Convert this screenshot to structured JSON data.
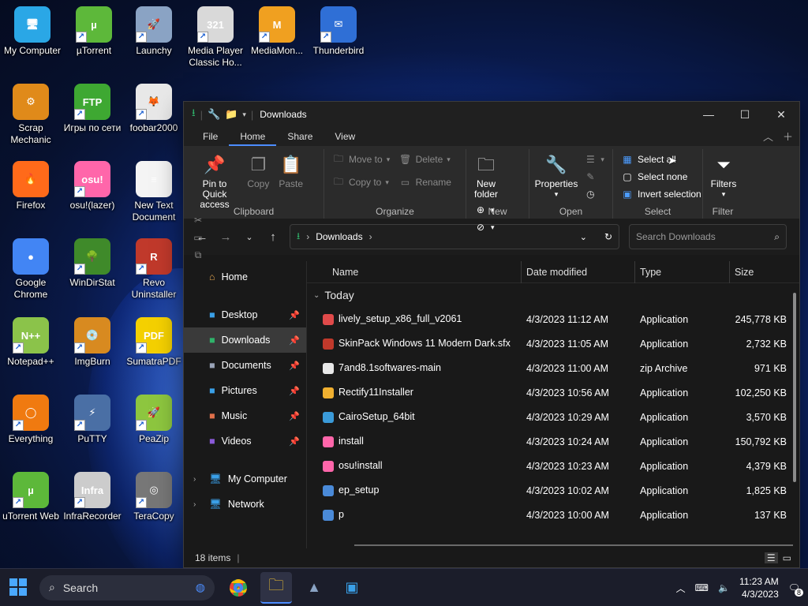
{
  "desktop": {
    "icons": [
      {
        "label": "My Computer",
        "color": "#2aa7e6",
        "glyph": "🖥"
      },
      {
        "label": "µTorrent",
        "color": "#5db83a",
        "glyph": "µ",
        "sc": true
      },
      {
        "label": "Launchy",
        "color": "#8aa3c4",
        "glyph": "🚀",
        "sc": true
      },
      {
        "label": "Media Player Classic Ho...",
        "color": "#d9d9d9",
        "glyph": "321",
        "sc": true
      },
      {
        "label": "MediaMon...",
        "color": "#f0a020",
        "glyph": "M",
        "sc": true
      },
      {
        "label": "Thunderbird",
        "color": "#2f6fd6",
        "glyph": "✉",
        "sc": true
      },
      {
        "label": "Scrap Mechanic",
        "color": "#e08a1a",
        "glyph": "⚙"
      },
      {
        "label": "Игры по сети",
        "color": "#3ea832",
        "glyph": "FTP",
        "sc": true
      },
      {
        "label": "foobar2000",
        "color": "#e8e8e8",
        "glyph": "🦊",
        "sc": true
      },
      {
        "label": "Firefox",
        "color": "#ff6a1a",
        "glyph": "🔥"
      },
      {
        "label": "osu!(lazer)",
        "color": "#ff66aa",
        "glyph": "osu!",
        "sc": true
      },
      {
        "label": "New Text Document",
        "color": "#f4f4f4",
        "glyph": "≡"
      },
      {
        "label": "Google Chrome",
        "color": "#4285f4",
        "glyph": "●"
      },
      {
        "label": "WinDirStat",
        "color": "#3f8a2a",
        "glyph": "🌳",
        "sc": true
      },
      {
        "label": "Revo Uninstaller",
        "color": "#c0392b",
        "glyph": "R",
        "sc": true
      },
      {
        "label": "Notepad++",
        "color": "#8bc34a",
        "glyph": "N++",
        "sc": true
      },
      {
        "label": "ImgBurn",
        "color": "#d88a20",
        "glyph": "💿",
        "sc": true
      },
      {
        "label": "SumatraPDF",
        "color": "#f4d000",
        "glyph": "PDF",
        "sc": true
      },
      {
        "label": "Everything",
        "color": "#f07a10",
        "glyph": "◯",
        "sc": true
      },
      {
        "label": "PuTTY",
        "color": "#4a6fa5",
        "glyph": "⚡",
        "sc": true
      },
      {
        "label": "PeaZip",
        "color": "#8dc63f",
        "glyph": "🚀",
        "sc": true
      },
      {
        "label": "uTorrent Web",
        "color": "#5db83a",
        "glyph": "µ",
        "sc": true
      },
      {
        "label": "InfraRecorder",
        "color": "#cccccc",
        "glyph": "Infra",
        "sc": true
      },
      {
        "label": "TeraCopy",
        "color": "#777777",
        "glyph": "◎",
        "sc": true
      }
    ]
  },
  "explorer": {
    "title": "Downloads",
    "tabs": [
      "File",
      "Home",
      "Share",
      "View"
    ],
    "active_tab": "Home",
    "ribbon": {
      "clipboard": {
        "pin": "Pin to Quick access",
        "copy": "Copy",
        "paste": "Paste",
        "label": "Clipboard"
      },
      "organize": {
        "move_to": "Move to",
        "copy_to": "Copy to",
        "delete": "Delete",
        "rename": "Rename",
        "label": "Organize"
      },
      "new": {
        "new_folder": "New folder",
        "label": "New"
      },
      "open": {
        "properties": "Properties",
        "label": "Open"
      },
      "select": {
        "select_all": "Select all",
        "select_none": "Select none",
        "invert": "Invert selection",
        "label": "Select"
      },
      "filter": {
        "filters": "Filters",
        "label": "Filter"
      }
    },
    "address": {
      "path": "Downloads",
      "search_placeholder": "Search Downloads"
    },
    "nav": {
      "home": "Home",
      "quick": [
        {
          "label": "Desktop",
          "color": "#3aa0e8"
        },
        {
          "label": "Downloads",
          "color": "#2fb36a",
          "selected": true
        },
        {
          "label": "Documents",
          "color": "#9aa4b8"
        },
        {
          "label": "Pictures",
          "color": "#3aa0e8"
        },
        {
          "label": "Music",
          "color": "#e0704a"
        },
        {
          "label": "Videos",
          "color": "#8a5ad8"
        }
      ],
      "tree": [
        {
          "label": "My Computer"
        },
        {
          "label": "Network"
        }
      ]
    },
    "columns": [
      "Name",
      "Date modified",
      "Type",
      "Size"
    ],
    "group": "Today",
    "files": [
      {
        "name": "lively_setup_x86_full_v2061",
        "date": "4/3/2023 11:12 AM",
        "type": "Application",
        "size": "245,778 KB",
        "color": "#e04a4a"
      },
      {
        "name": "SkinPack Windows 11 Modern Dark.sfx",
        "date": "4/3/2023 11:05 AM",
        "type": "Application",
        "size": "2,732 KB",
        "color": "#c0392b"
      },
      {
        "name": "7and8.1softwares-main",
        "date": "4/3/2023 11:00 AM",
        "type": "zip Archive",
        "size": "971 KB",
        "color": "#e8e8e8"
      },
      {
        "name": "Rectify11Installer",
        "date": "4/3/2023 10:56 AM",
        "type": "Application",
        "size": "102,250 KB",
        "color": "#f0b030"
      },
      {
        "name": "CairoSetup_64bit",
        "date": "4/3/2023 10:29 AM",
        "type": "Application",
        "size": "3,570 KB",
        "color": "#3a9ad8"
      },
      {
        "name": "install",
        "date": "4/3/2023 10:24 AM",
        "type": "Application",
        "size": "150,792 KB",
        "color": "#ff66aa"
      },
      {
        "name": "osu!install",
        "date": "4/3/2023 10:23 AM",
        "type": "Application",
        "size": "4,379 KB",
        "color": "#ff66aa"
      },
      {
        "name": "ep_setup",
        "date": "4/3/2023 10:02 AM",
        "type": "Application",
        "size": "1,825 KB",
        "color": "#4a8ad8"
      },
      {
        "name": "p",
        "date": "4/3/2023 10:00 AM",
        "type": "Application",
        "size": "137 KB",
        "color": "#4a8ad8"
      }
    ],
    "status": "18 items"
  },
  "taskbar": {
    "search": "Search",
    "time": "11:23 AM",
    "date": "4/3/2023",
    "notif_count": "8"
  }
}
